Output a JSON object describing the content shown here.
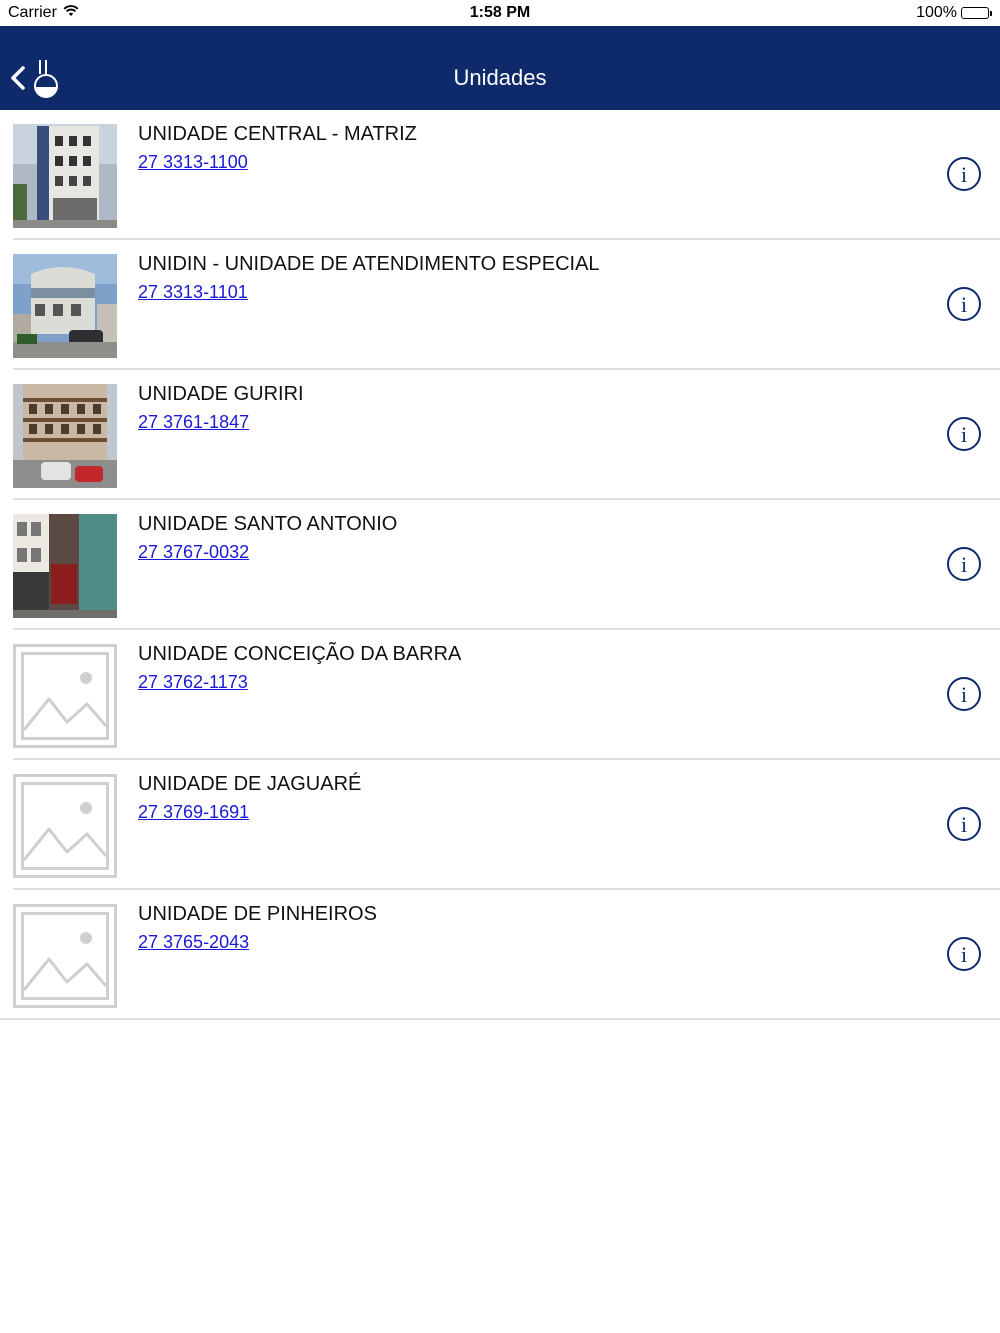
{
  "status_bar": {
    "carrier": "Carrier",
    "time": "1:58 PM",
    "battery": "100%"
  },
  "nav": {
    "title": "Unidades",
    "back_icon": "chevron-left-icon",
    "logo_icon": "flask-icon"
  },
  "colors": {
    "nav_background": "#0e2a6b",
    "link": "#1a1ad6",
    "info_icon": "#0e2a6b"
  },
  "units": [
    {
      "name": "UNIDADE CENTRAL - MATRIZ",
      "phone": "27 3313-1100",
      "photo": "building-photo"
    },
    {
      "name": "UNIDIN - UNIDADE DE ATENDIMENTO ESPECIAL",
      "phone": "27 3313-1101",
      "photo": "building-photo"
    },
    {
      "name": "UNIDADE GURIRI",
      "phone": "27 3761-1847",
      "photo": "building-photo"
    },
    {
      "name": "UNIDADE SANTO ANTONIO",
      "phone": "27 3767-0032",
      "photo": "building-photo"
    },
    {
      "name": "UNIDADE CONCEIÇÃO DA BARRA",
      "phone": "27 3762-1173",
      "photo": "image-placeholder-icon"
    },
    {
      "name": "UNIDADE DE JAGUARÉ",
      "phone": "27 3769-1691",
      "photo": "image-placeholder-icon"
    },
    {
      "name": "UNIDADE DE PINHEIROS",
      "phone": "27 3765-2043",
      "photo": "image-placeholder-icon"
    }
  ]
}
